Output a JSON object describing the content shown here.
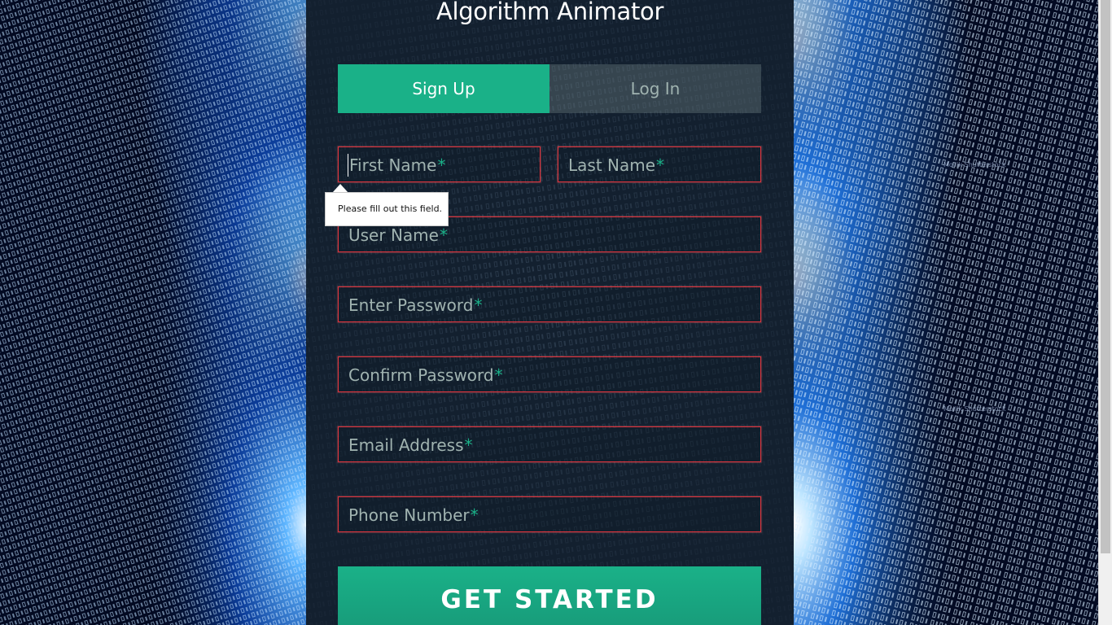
{
  "app": {
    "title": "Algorithm Animator"
  },
  "tabs": [
    {
      "label": "Sign Up",
      "active": true
    },
    {
      "label": "Log In",
      "active": false
    }
  ],
  "form": {
    "first_name": {
      "placeholder": "First Name",
      "value": ""
    },
    "last_name": {
      "placeholder": "Last Name",
      "value": ""
    },
    "user_name": {
      "placeholder": "User Name",
      "value": ""
    },
    "password": {
      "placeholder": "Enter Password",
      "value": ""
    },
    "confirm_password": {
      "placeholder": "Confirm Password",
      "value": ""
    },
    "email": {
      "placeholder": "Email Address",
      "value": ""
    },
    "phone": {
      "placeholder": "Phone Number",
      "value": ""
    },
    "required_marker": "*",
    "validation_message": "Please fill out this field.",
    "submit_label": "GET STARTED"
  },
  "background": {
    "watermark": "Moilik Shutterstock"
  },
  "colors": {
    "accent": "#1ab188",
    "error_border": "#e2343d",
    "card": "#142230",
    "placeholder": "#a0b3b0"
  }
}
